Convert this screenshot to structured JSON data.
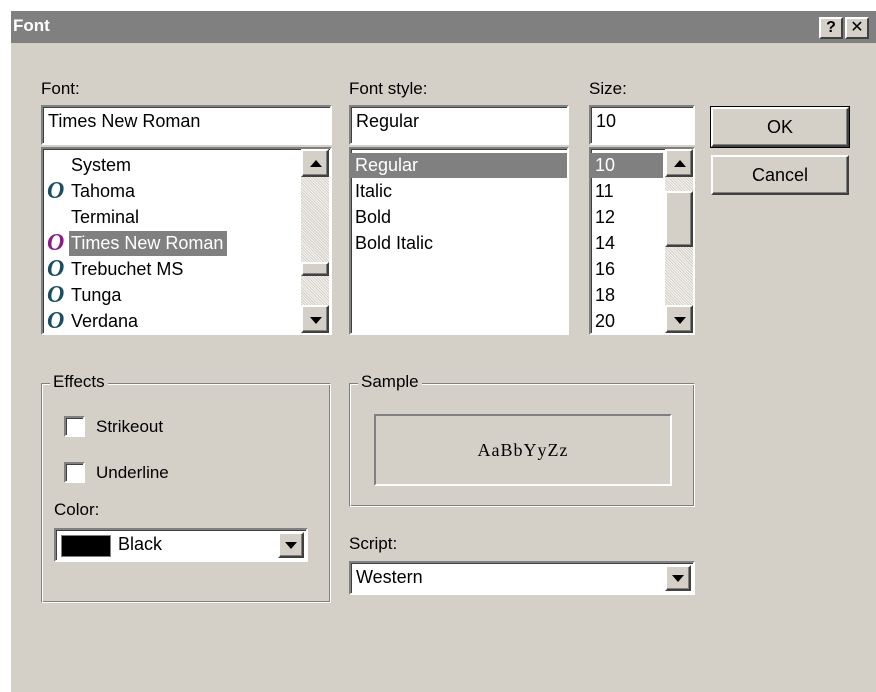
{
  "window": {
    "title": "Font",
    "help_label": "?",
    "close_label": "✕"
  },
  "font": {
    "label": "Font:",
    "value": "Times New Roman",
    "items": [
      {
        "name": "System",
        "icon": "none"
      },
      {
        "name": "Tahoma",
        "icon": "opentype-font-icon"
      },
      {
        "name": "Terminal",
        "icon": "none"
      },
      {
        "name": "Times New Roman",
        "icon": "opentype-font-icon",
        "selected": true
      },
      {
        "name": "Trebuchet MS",
        "icon": "opentype-font-icon"
      },
      {
        "name": "Tunga",
        "icon": "opentype-font-icon"
      },
      {
        "name": "Verdana",
        "icon": "opentype-font-icon"
      }
    ],
    "icon_glyph": "O"
  },
  "style": {
    "label": "Font style:",
    "value": "Regular",
    "items": [
      "Regular",
      "Italic",
      "Bold",
      "Bold Italic"
    ],
    "selected_index": 0
  },
  "size": {
    "label": "Size:",
    "value": "10",
    "items": [
      "10",
      "11",
      "12",
      "14",
      "16",
      "18",
      "20"
    ],
    "selected_index": 0
  },
  "buttons": {
    "ok": "OK",
    "cancel": "Cancel"
  },
  "effects": {
    "title": "Effects",
    "strikeout": {
      "label": "Strikeout",
      "checked": false
    },
    "underline": {
      "label": "Underline",
      "checked": false
    },
    "color_label": "Color:",
    "color_value": "Black",
    "color_swatch": "#000000"
  },
  "sample": {
    "title": "Sample",
    "text": "AaBbYyZz"
  },
  "script": {
    "label": "Script:",
    "value": "Western"
  },
  "colors": {
    "face": "#d4d0c8",
    "titlebar": "#808080",
    "selection": "#808080",
    "icon_teal": "#1a4f63",
    "icon_selected": "#8b1a8b"
  }
}
